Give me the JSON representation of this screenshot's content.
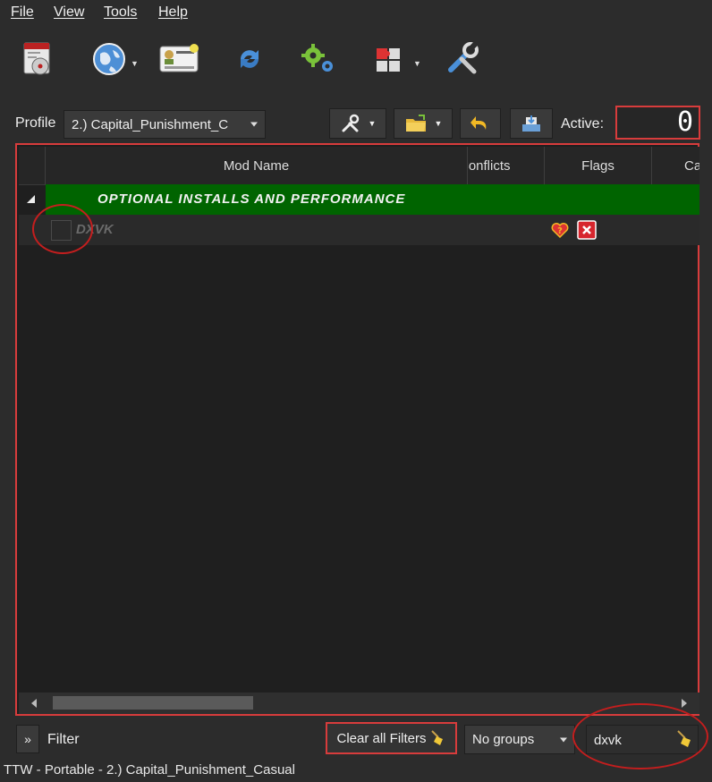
{
  "menu": {
    "file": "File",
    "view": "View",
    "tools": "Tools",
    "help": "Help"
  },
  "toolbar": {
    "icons": [
      "install-mod-icon",
      "nexus-globe-icon",
      "profiles-icon",
      "refresh-icon",
      "executables-icon",
      "plugins-icon",
      "settings-icon"
    ]
  },
  "profile": {
    "label": "Profile",
    "selected": "2.) Capital_Punishment_C",
    "active_label": "Active:",
    "active_value": "0"
  },
  "modlist": {
    "columns": {
      "mod_name": "Mod Name",
      "conflicts": "Conflicts",
      "flags": "Flags",
      "category": "Ca"
    },
    "group_label": "OPTIONAL INSTALLS AND PERFORMANCE",
    "mods": [
      {
        "name": "DXVK",
        "enabled": false
      }
    ]
  },
  "bottom": {
    "expand": "»",
    "filter_label": "Filter",
    "clear_filters": "Clear all Filters",
    "groups_selected": "No groups",
    "search_value": "dxvk"
  },
  "status_bar": {
    "text": "TTW - Portable - 2.) Capital_Punishment_Casual"
  },
  "colors": {
    "group_bg": "#006400",
    "highlight": "#d83c3c",
    "annotation": "#c41e1e"
  }
}
